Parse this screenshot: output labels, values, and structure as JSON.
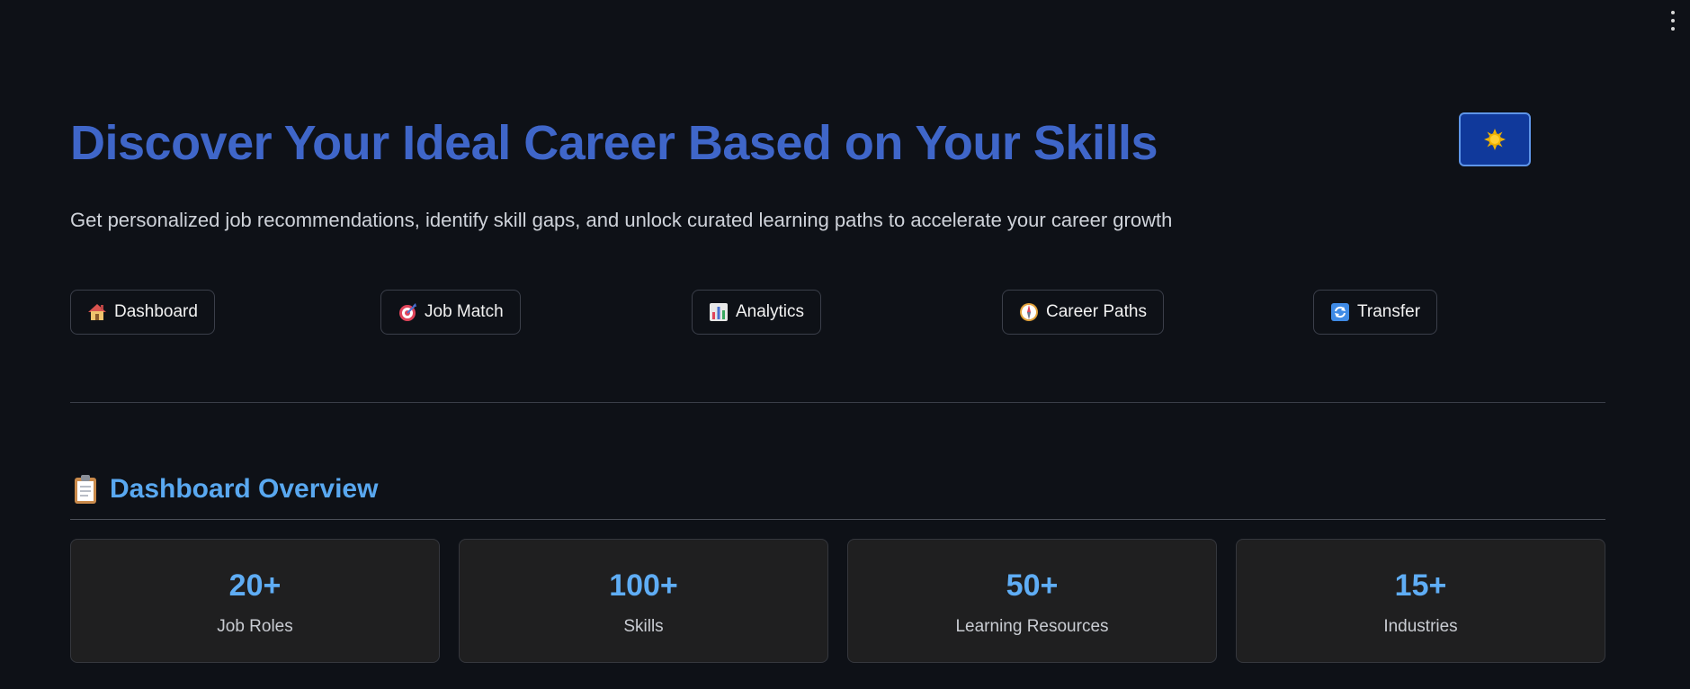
{
  "header": {
    "title": "Discover Your Ideal Career Based on Your Skills",
    "subtitle": "Get personalized job recommendations, identify skill gaps, and unlock curated learning paths to accelerate your career growth",
    "theme_toggle_icon": "sun-icon"
  },
  "nav": {
    "items": [
      {
        "label": "Dashboard",
        "icon": "house-icon"
      },
      {
        "label": "Job Match",
        "icon": "target-icon"
      },
      {
        "label": "Analytics",
        "icon": "bar-chart-icon"
      },
      {
        "label": "Career Paths",
        "icon": "compass-icon"
      },
      {
        "label": "Transfer",
        "icon": "refresh-icon"
      }
    ]
  },
  "section": {
    "title": "Dashboard Overview",
    "icon": "clipboard-icon"
  },
  "stats": [
    {
      "value": "20+",
      "label": "Job Roles"
    },
    {
      "value": "100+",
      "label": "Skills"
    },
    {
      "value": "50+",
      "label": "Learning Resources"
    },
    {
      "value": "15+",
      "label": "Industries"
    }
  ],
  "colors": {
    "background": "#0e1117",
    "title": "#3f66c9",
    "accent": "#5fadf5",
    "card": "#1f1f20"
  }
}
